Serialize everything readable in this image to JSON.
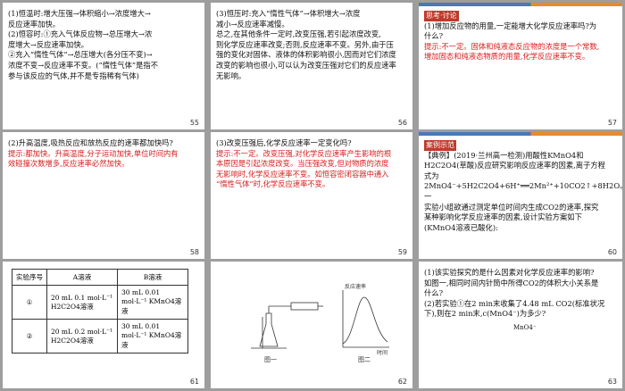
{
  "slides": [
    {
      "num": "55",
      "lines": [
        "(1)恒温时:增大压强→体积缩小→浓度增大→",
        "反应速率加快。",
        "(2)恒容时:①充入气体反应物→总压增大→浓",
        "度增大→反应速率加快。",
        "②充入“惰性气体”→总压增大(各分压不变)→",
        "浓度不变→反应速率不变。(“惰性气体”是指不",
        "参与该反应的气体,并不是专指稀有气体)"
      ]
    },
    {
      "num": "56",
      "lines": [
        "(3)恒压时:充入“惰性气体”→体积增大→浓度",
        "减小→反应速率减慢。",
        "总之,在其他条件一定时,改变压强,若引起浓度改变,",
        "则化学反应速率改变;否则,反应速率不变。另外,由于压",
        "强的变化对固体、液体的体积影响很小,因而对它们浓度",
        "改变的影响也很小,可以认为改变压强对它们的反应速率",
        "无影响。"
      ]
    },
    {
      "num": "57",
      "tag": "思考·讨论",
      "lines": [
        "(1)增加反应物的用量,一定能增大化学反应速率吗?为",
        "什么?",
        "提示:不一定。固体和纯液态反应物的浓度是一个常数,",
        "增加固态和纯液态物质的用量,化学反应速率不变。"
      ]
    },
    {
      "num": "58",
      "lines": [
        "(2)升高温度,吸热反应和放热反应的速率都加快吗?",
        "提示:都加快。升高温度,分子运动加快,单位时间内有",
        "效碰撞次数增多,反应速率必然加快。"
      ]
    },
    {
      "num": "59",
      "lines": [
        "(3)改变压强后,化学反应速率一定变化吗?",
        "提示:不一定。改变压强,对化学反应速率产生影响的根",
        "本原因是引起浓度改变。当压强改变,但对物质的浓度",
        "无影响时,化学反应速率不变。如恒容密闭容器中通入",
        "“惰性气体”时,化学反应速率不变。"
      ]
    },
    {
      "num": "60",
      "tag": "案例示范",
      "lines": [
        "【典例】(2019·兰州高一检测)用酸性KMnO4和",
        "H2C2O4(草酸)反应研究影响反应速率的因素,离子方程",
        "式为2MnO4⁻+5H2C2O4+6H⁺══2Mn²⁺+10CO2↑+8H2O。一",
        "实验小组欲通过测定单位时间内生成CO2的速率,探究",
        "某种影响化学反应速率的因素,设计实验方案如下",
        "(KMnO4溶液已酸化):"
      ]
    },
    {
      "num": "61",
      "table": {
        "headers": [
          "实验序号",
          "A溶液",
          "B溶液"
        ],
        "rows": [
          [
            "①",
            "20 mL 0.1 mol·L⁻¹ H2C2O4溶液",
            "30 mL 0.01 mol·L⁻¹ KMnO4溶液"
          ],
          [
            "②",
            "20 mL 0.2 mol·L⁻¹ H2C2O4溶液",
            "30 mL 0.01 mol·L⁻¹ KMnO4溶液"
          ]
        ]
      }
    },
    {
      "num": "62",
      "fig": {
        "ylabel": "反应速率",
        "xlabel": "时间",
        "cap1": "图一",
        "cap2": "图二"
      }
    },
    {
      "num": "63",
      "lines": [
        "(1)该实验探究的是什么因素对化学反应速率的影响?",
        "如图一,相同时间内针筒中所得CO2的体积大小关系是",
        "什么?",
        "(2)若实验①在2 min末收集了4.48 mL CO2(标准状况",
        "下),则在2 min末,c(MnO4⁻)为多少?"
      ],
      "extra": "MnO4⁻"
    }
  ]
}
